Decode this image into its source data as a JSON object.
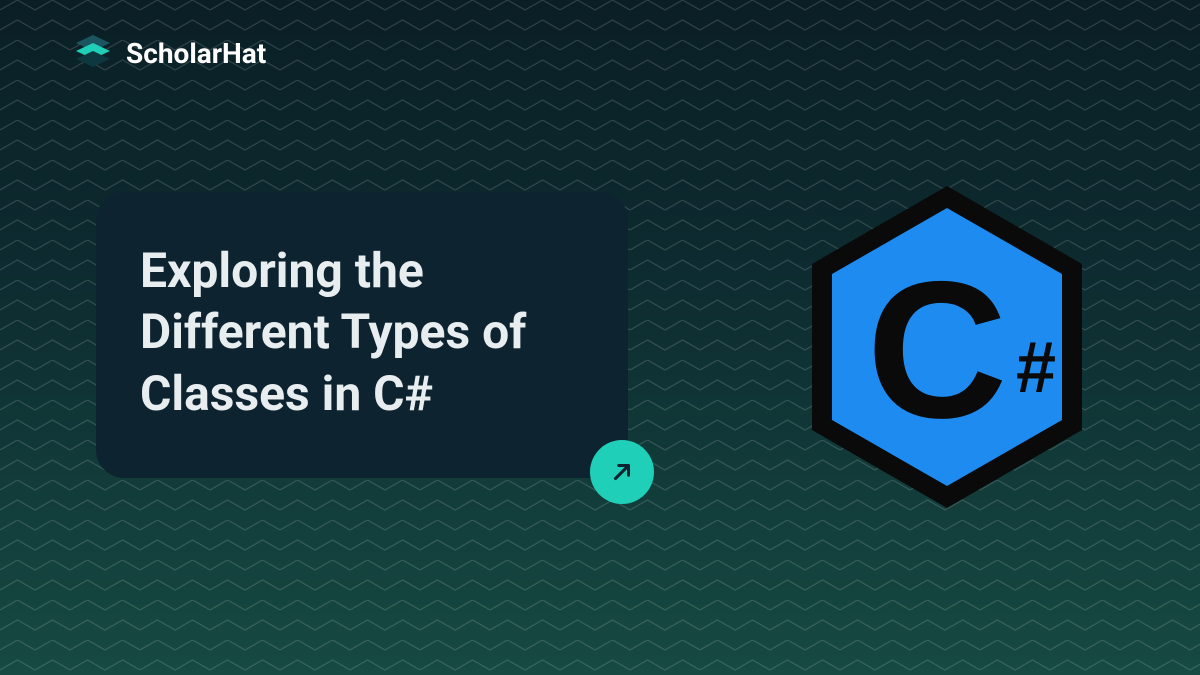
{
  "brand": {
    "name": "ScholarHat"
  },
  "card": {
    "title": "Exploring the Different Types of Classes in C#"
  },
  "language_logo": {
    "name": "C#",
    "letter": "C",
    "hash": "#"
  },
  "colors": {
    "accent": "#1fcfb8",
    "card_bg": "#0d2430",
    "csharp_blue": "#1d8bf0",
    "csharp_border": "#0a0a0a"
  }
}
